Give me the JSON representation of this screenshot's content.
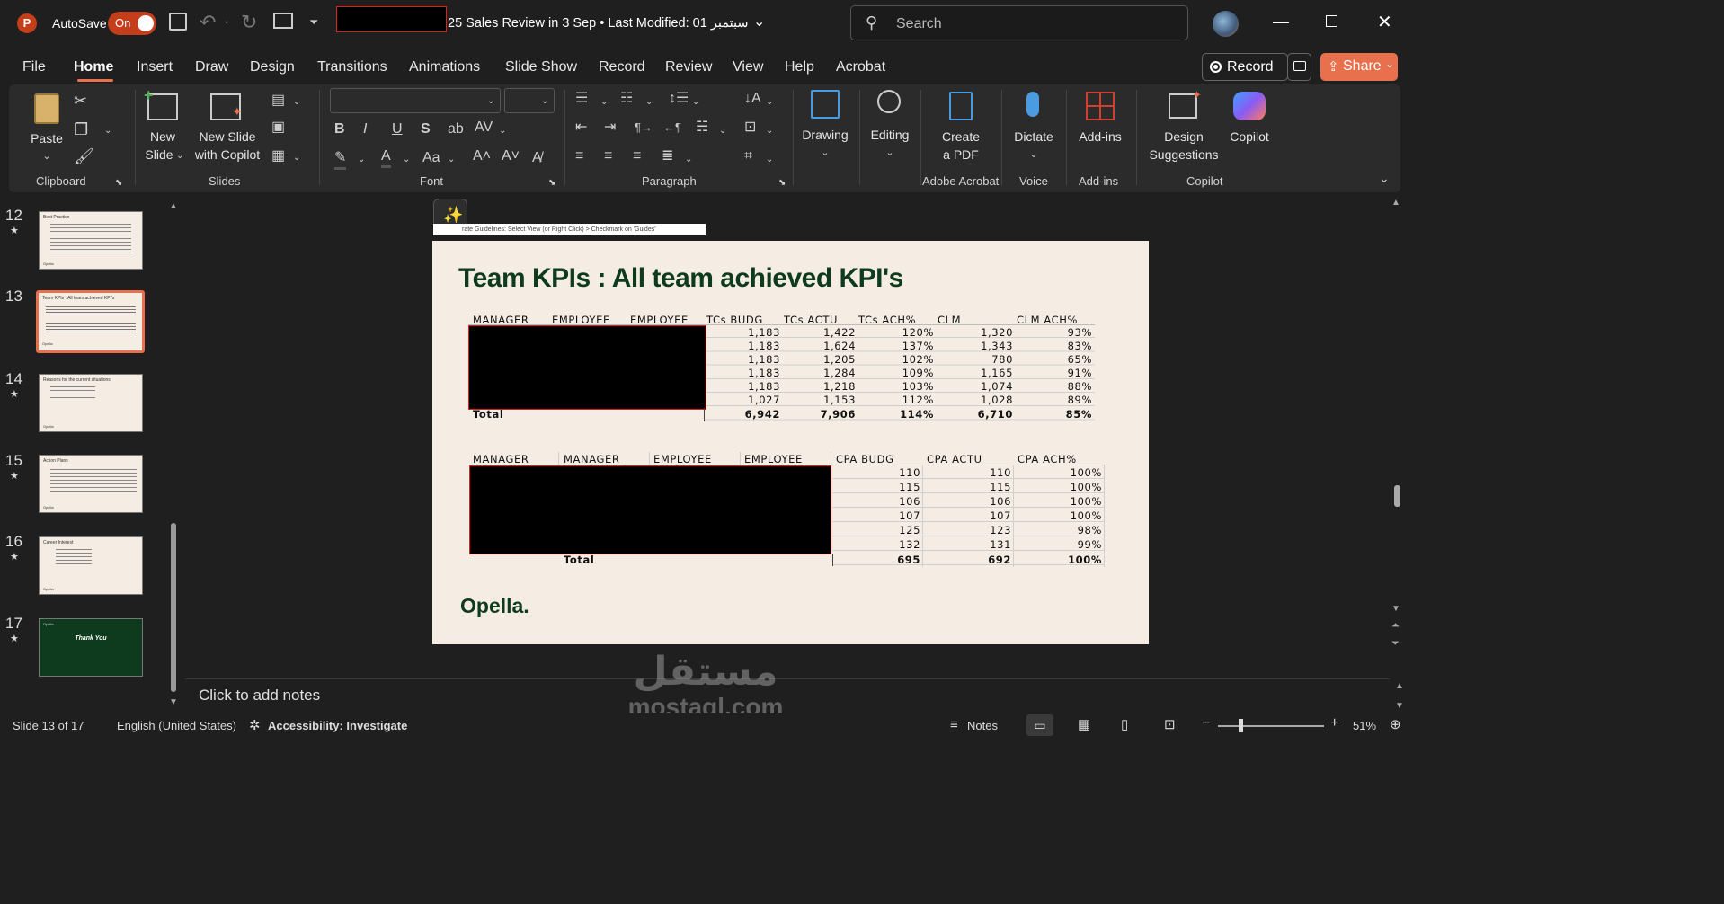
{
  "titlebar": {
    "app_icon": "powerpoint-icon",
    "autosave_label": "AutoSave",
    "autosave_state": "On",
    "doc_title": "25 Sales Review in 3 Sep  •  Last Modified: 01 سبتمبر",
    "search_placeholder": "Search"
  },
  "menu": {
    "tabs": [
      "File",
      "Home",
      "Insert",
      "Draw",
      "Design",
      "Transitions",
      "Animations",
      "Slide Show",
      "Record",
      "Review",
      "View",
      "Help",
      "Acrobat"
    ],
    "record_label": "Record",
    "share_label": "Share"
  },
  "ribbon": {
    "paste": "Paste",
    "new_slide": [
      "New",
      "Slide"
    ],
    "new_slide_copilot": [
      "New Slide",
      "with Copilot"
    ],
    "drawing": "Drawing",
    "editing": "Editing",
    "create_pdf": [
      "Create",
      "a PDF"
    ],
    "dictate": "Dictate",
    "addins": "Add-ins",
    "design_suggestions": [
      "Design",
      "Suggestions"
    ],
    "copilot": "Copilot",
    "groups": [
      "Clipboard",
      "Slides",
      "Font",
      "Paragraph",
      "Adobe Acrobat",
      "Voice",
      "Add-ins",
      "Copilot"
    ]
  },
  "thumbnails": [
    {
      "num": "12",
      "title": "Best Practice",
      "footer": "Opella"
    },
    {
      "num": "13",
      "title": "Team KPIs : All team achieved KPI's",
      "footer": "Opella"
    },
    {
      "num": "14",
      "title": "Reasons for the current situations",
      "footer": "Opella"
    },
    {
      "num": "15",
      "title": "Action Plans",
      "footer": "Opella"
    },
    {
      "num": "16",
      "title": "Career Interest",
      "footer": "Opella"
    },
    {
      "num": "17",
      "title": "Thank You",
      "footer": "Opella"
    }
  ],
  "guide_note": "rate Guidelines: Select View (or Right Click) > Checkmark on 'Guides'",
  "slide": {
    "title": "Team KPIs : All team achieved KPI's",
    "brand": "Opella.",
    "table1": {
      "headers": [
        "MANAGER",
        "EMPLOYEE",
        "EMPLOYEE",
        "TCs BUDG",
        "TCs ACTU",
        "TCs ACH%",
        "CLM",
        "CLM ACH%"
      ],
      "rows": [
        [
          "1,183",
          "1,422",
          "120%",
          "1,320",
          "93%"
        ],
        [
          "1,183",
          "1,624",
          "137%",
          "1,343",
          "83%"
        ],
        [
          "1,183",
          "1,205",
          "102%",
          "780",
          "65%"
        ],
        [
          "1,183",
          "1,284",
          "109%",
          "1,165",
          "91%"
        ],
        [
          "1,183",
          "1,218",
          "103%",
          "1,074",
          "88%"
        ],
        [
          "1,027",
          "1,153",
          "112%",
          "1,028",
          "89%"
        ]
      ],
      "total_label": "Total",
      "total": [
        "6,942",
        "7,906",
        "114%",
        "6,710",
        "85%"
      ]
    },
    "table2": {
      "headers": [
        "MANAGER",
        "MANAGER",
        "EMPLOYEE",
        "EMPLOYEE",
        "CPA BUDG",
        "CPA ACTU",
        "CPA ACH%"
      ],
      "rows": [
        [
          "110",
          "110",
          "100%"
        ],
        [
          "115",
          "115",
          "100%"
        ],
        [
          "106",
          "106",
          "100%"
        ],
        [
          "107",
          "107",
          "100%"
        ],
        [
          "125",
          "123",
          "98%"
        ],
        [
          "132",
          "131",
          "99%"
        ]
      ],
      "total_label": "Total",
      "total": [
        "695",
        "692",
        "100%"
      ]
    }
  },
  "notes_placeholder": "Click to add notes",
  "status": {
    "slide": "Slide 13 of 17",
    "language": "English (United States)",
    "accessibility": "Accessibility: Investigate",
    "notes": "Notes",
    "zoom": "51%"
  },
  "watermark": {
    "arabic": "مستقل",
    "latin": "mostaql.com"
  },
  "colors": {
    "accent": "#c43e1c",
    "share": "#e8704c",
    "slide_bg": "#f5ede3",
    "title_green": "#0e3b1e"
  }
}
